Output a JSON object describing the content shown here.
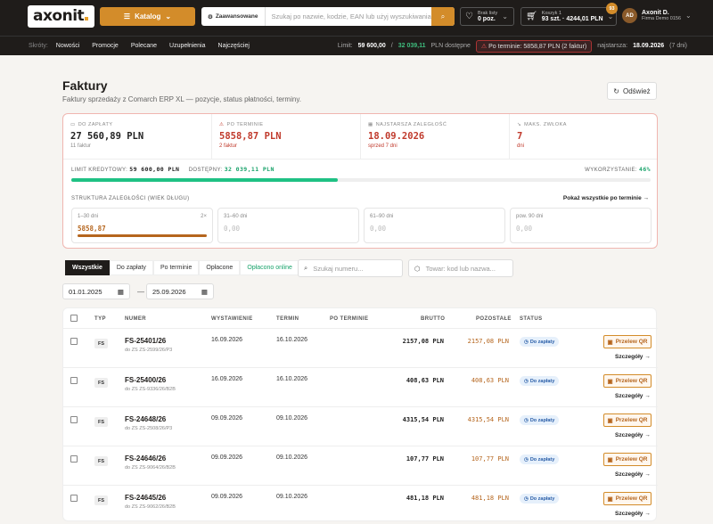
{
  "header": {
    "logo": "axonit",
    "catalog_label": "Katalog",
    "search_adv": "Zaawansowane",
    "search_placeholder": "Szukaj po nazwie, kodzie, EAN lub użyj wyszukiwania...",
    "list_top": "Brak listy",
    "list_bottom": "0 poz.",
    "cart_top": "Koszyk 1",
    "cart_bottom": "93 szt. · 4244,01 PLN",
    "cart_badge": "93",
    "avatar": "AD",
    "user_name": "Axonit D.",
    "user_company": "Firma Demo 0156"
  },
  "subnav": {
    "label": "Skróty:",
    "items": [
      "Nowości",
      "Promocje",
      "Polecane",
      "Uzupełnienia",
      "Najczęściej"
    ],
    "limit_label": "Limit:",
    "limit_value": "59 600,00",
    "available_value": "32 039,11",
    "available_text": "PLN dostępne",
    "overdue_pill": "Po terminie: 5858,87 PLN (2 faktur)",
    "oldest_label": "najstarsza:",
    "oldest_value": "18.09.2026",
    "oldest_days": "(7 dni)"
  },
  "page": {
    "title": "Faktury",
    "subtitle": "Faktury sprzedaży z Comarch ERP XL — pozycje, status płatności, terminy.",
    "refresh": "Odśwież"
  },
  "kpis": [
    {
      "title": "DO ZAPŁATY",
      "value": "27 560,89 PLN",
      "note": "11 faktur",
      "icon": "card-icon"
    },
    {
      "title": "PO TERMINIE",
      "value": "5858,87 PLN",
      "note": "2 faktur",
      "icon": "warning-icon"
    },
    {
      "title": "NAJSTARSZA ZALEGŁOŚĆ",
      "value": "18.09.2026",
      "note": "sprzed 7 dni",
      "icon": "calendar-icon"
    },
    {
      "title": "MAKS. ZWŁOKA",
      "value": "7",
      "note": "dni",
      "icon": "trend-icon"
    }
  ],
  "credit": {
    "limit_label": "LIMIT KREDYTOWY:",
    "limit_value": "59 600,00 PLN",
    "available_label": "DOSTĘPNY:",
    "available_value": "32 039,11 PLN",
    "used_label": "WYKORZYSTANIE:",
    "used_value": "46%",
    "used_fraction": 0.46
  },
  "aging": {
    "title": "STRUKTURA ZALEGŁOŚCI (WIEK DŁUGU)",
    "link": "Pokaż wszystkie po terminie →",
    "buckets": [
      {
        "label": "1–30 dni",
        "count": "2×",
        "value": "5858,87",
        "fill": 1.0
      },
      {
        "label": "31–60 dni",
        "count": "",
        "value": "0,00",
        "fill": 0
      },
      {
        "label": "61–90 dni",
        "count": "",
        "value": "0,00",
        "fill": 0
      },
      {
        "label": "pow. 90 dni",
        "count": "",
        "value": "0,00",
        "fill": 0
      }
    ]
  },
  "filters": {
    "tabs": [
      "Wszystkie",
      "Do zapłaty",
      "Po terminie",
      "Opłacone",
      "Opłacono online"
    ],
    "search_number": "Szukaj numeru...",
    "search_product": "Towar: kod lub nazwa...",
    "date_from": "01.01.2025",
    "date_to": "25.09.2026"
  },
  "table": {
    "headers": [
      "TYP",
      "NUMER",
      "WYSTAWIENIE",
      "TERMIN",
      "PO TERMINIE",
      "BRUTTO",
      "POZOSTAŁE",
      "STATUS"
    ],
    "rows": [
      {
        "type": "FS",
        "number": "FS-25401/26",
        "order": "do ZS ZS-2599/26/P3",
        "issued": "16.09.2026",
        "due": "16.10.2026",
        "gross": "2157,08 PLN",
        "remaining": "2157,08 PLN",
        "status": "Do zapłaty",
        "qr": "Przelew QR",
        "details": "Szczegóły →"
      },
      {
        "type": "FS",
        "number": "FS-25400/26",
        "order": "do ZS ZS-9336/26/B2B",
        "issued": "16.09.2026",
        "due": "16.10.2026",
        "gross": "408,63 PLN",
        "remaining": "408,63 PLN",
        "status": "Do zapłaty",
        "qr": "Przelew QR",
        "details": "Szczegóły →"
      },
      {
        "type": "FS",
        "number": "FS-24648/26",
        "order": "do ZS ZS-2508/26/P3",
        "issued": "09.09.2026",
        "due": "09.10.2026",
        "gross": "4315,54 PLN",
        "remaining": "4315,54 PLN",
        "status": "Do zapłaty",
        "qr": "Przelew QR",
        "details": "Szczegóły →"
      },
      {
        "type": "FS",
        "number": "FS-24646/26",
        "order": "do ZS ZS-9064/26/B2B",
        "issued": "09.09.2026",
        "due": "09.10.2026",
        "gross": "107,77 PLN",
        "remaining": "107,77 PLN",
        "status": "Do zapłaty",
        "qr": "Przelew QR",
        "details": "Szczegóły →"
      },
      {
        "type": "FS",
        "number": "FS-24645/26",
        "order": "do ZS ZS-9062/26/B2B",
        "issued": "09.09.2026",
        "due": "09.10.2026",
        "gross": "481,18 PLN",
        "remaining": "481,18 PLN",
        "status": "Do zapłaty",
        "qr": "Przelew QR",
        "details": "Szczegóły →"
      }
    ]
  },
  "colors": {
    "accent": "#d38c2a",
    "dark": "#1f1c1a",
    "danger": "#c0392b",
    "success": "#1fc184"
  }
}
